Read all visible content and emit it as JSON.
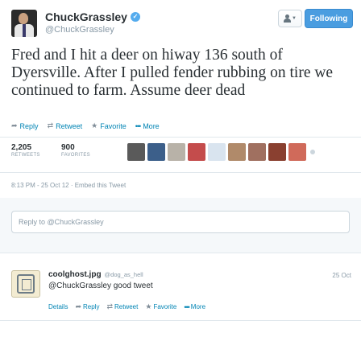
{
  "author": {
    "fullname": "ChuckGrassley",
    "screenname": "@ChuckGrassley",
    "verified_mark": "✓"
  },
  "header_buttons": {
    "follow_label": "Following",
    "user_dropdown_icon": "person-icon"
  },
  "tweet": {
    "text": "Fred and I hit a deer on hiway 136 south of Dyersville. After I pulled fender rubbing on tire we continued to farm. Assume deer dead",
    "actions": {
      "reply": "Reply",
      "retweet": "Retweet",
      "favorite": "Favorite",
      "more": "More"
    },
    "stats": {
      "retweets_count": "2,205",
      "retweets_label": "RETWEETS",
      "favorites_count": "900",
      "favorites_label": "FAVORITES"
    },
    "timestamp": "8:13 PM - 25 Oct 12",
    "embed_label": "Embed this Tweet"
  },
  "reply_box": {
    "placeholder": "Reply to @ChuckGrassley"
  },
  "reply_tweet": {
    "fullname": "coolghost.jpg",
    "screenname": "@dog_as_hell",
    "date": "25 Oct",
    "text": "@ChuckGrassley good tweet",
    "actions": {
      "details": "Details",
      "reply": "Reply",
      "retweet": "Retweet",
      "favorite": "Favorite",
      "more": "More"
    }
  },
  "colors": {
    "link": "#0084b4",
    "follow_button": "#4a9de0",
    "muted": "#8899a6"
  }
}
